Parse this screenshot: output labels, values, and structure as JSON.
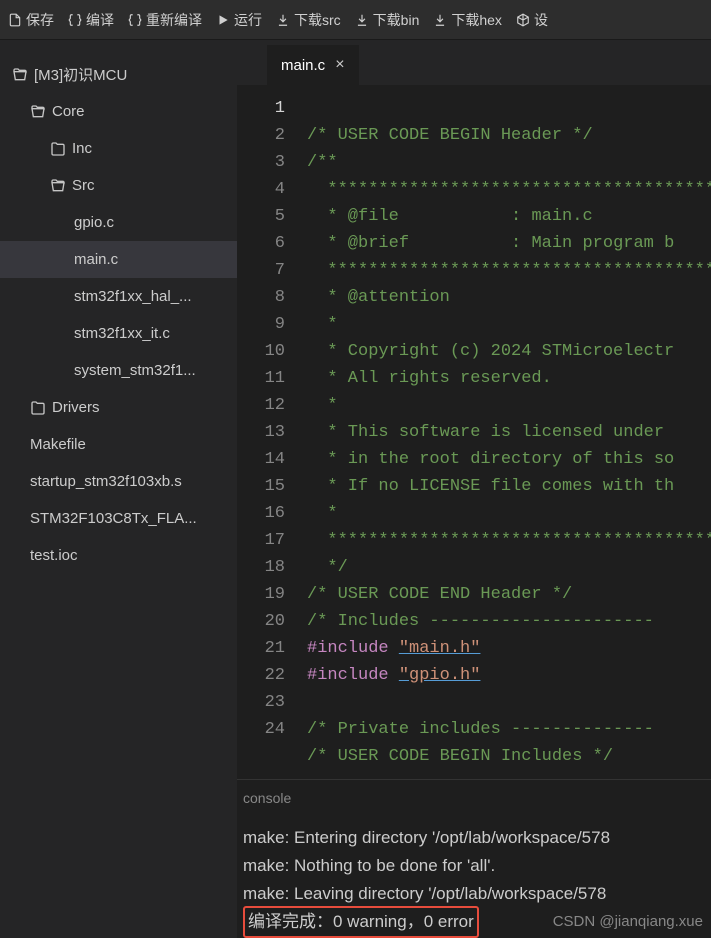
{
  "toolbar": {
    "save": "保存",
    "compile": "编译",
    "recompile": "重新编译",
    "run": "运行",
    "download_src": "下载src",
    "download_bin": "下载bin",
    "download_hex": "下载hex",
    "extra": "设"
  },
  "tree": {
    "root": "[M3]初识MCU",
    "core": "Core",
    "inc": "Inc",
    "src": "Src",
    "files": {
      "gpio_c": "gpio.c",
      "main_c": "main.c",
      "hal": "stm32f1xx_hal_...",
      "it": "stm32f1xx_it.c",
      "system": "system_stm32f1..."
    },
    "drivers": "Drivers",
    "makefile": "Makefile",
    "startup": "startup_stm32f103xb.s",
    "flash": "STM32F103C8Tx_FLA...",
    "test_ioc": "test.ioc"
  },
  "tabs": {
    "main_c": "main.c"
  },
  "code": {
    "lines": {
      "l1": "/* USER CODE BEGIN Header */",
      "l2": "/**",
      "l3": "  ******************************************",
      "l4a": "  * @file",
      "l4b": "           : main.c",
      "l5a": "  * @brief",
      "l5b": "          : Main program b",
      "l6": "  ******************************************",
      "l7": "  * @attention",
      "l8": "  *",
      "l9": "  * Copyright (c) 2024 STMicroelectr",
      "l10": "  * All rights reserved.",
      "l11": "  *",
      "l12": "  * This software is licensed under ",
      "l13": "  * in the root directory of this so",
      "l14": "  * If no LICENSE file comes with th",
      "l15": "  *",
      "l16": "  ******************************************",
      "l17": "  */",
      "l18": "/* USER CODE END Header */",
      "l19": "/* Includes ----------------------",
      "l20a": "#include",
      "l20b": "\"main.h\"",
      "l21a": "#include",
      "l21b": "\"gpio.h\"",
      "l23": "/* Private includes --------------",
      "l24": "/* USER CODE BEGIN Includes */"
    },
    "line_numbers": [
      "1",
      "2",
      "3",
      "4",
      "5",
      "6",
      "7",
      "8",
      "9",
      "10",
      "11",
      "12",
      "13",
      "14",
      "15",
      "16",
      "17",
      "18",
      "19",
      "20",
      "21",
      "22",
      "23",
      "24"
    ]
  },
  "console": {
    "title": "console",
    "lines": {
      "l1": "make: Entering directory '/opt/lab/workspace/578",
      "l2": "make: Nothing to be done for 'all'.",
      "l3": "make: Leaving directory '/opt/lab/workspace/578",
      "l4": "编译完成：0 warning，0 error"
    }
  },
  "watermark": "CSDN @jianqiang.xue"
}
